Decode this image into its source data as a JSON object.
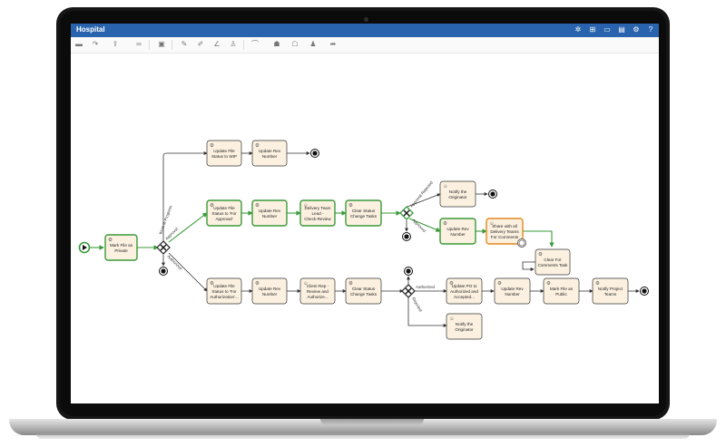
{
  "app": {
    "title": "Hospital"
  },
  "titlebar_icons": [
    "settings-gear-icon",
    "org-chart-icon",
    "chat-icon",
    "document-icon",
    "gear-icon",
    "help-icon"
  ],
  "toolbar_tools": [
    "open-folder-icon",
    "redo-icon",
    "upload-icon",
    "link-icon",
    "save-icon",
    "pencil-icon",
    "edit-icon",
    "angle-icon",
    "person-icon",
    "curve-icon",
    "users-icon",
    "group-icon",
    "add-user-icon",
    "forward-icon"
  ],
  "process": {
    "tasks": {
      "mark_private": "Mark File as Private",
      "update_wip": "Update File Status to WIP",
      "update_rev_top": "Update Rev Number",
      "update_for_approval": "Update File Status to 'For Approval'",
      "update_rev_mid": "Update Rev Number",
      "delivery_team": "Delivery Team Lead - Check-Review Approv...",
      "clear_status_mid": "Clear Status Change Tasks",
      "notify_originator_top": "Notify the Originator",
      "update_rev_right": "Update Rev Number",
      "share_delivery": "Share with all Delivery Teams For Comments",
      "clear_comments": "Clear For Comments Task",
      "update_for_authorization": "Update File Status to 'For Authorization'...",
      "update_rev_bottom": "Update Rev Number",
      "client_rep": "Client Rep - Review and Authorize...",
      "clear_status_bottom": "Clear Status Change Tasks",
      "update_po": "Update PO to Authorized and Accepted...",
      "update_rev_end": "Update Rev Number",
      "mark_public": "Mark File as Public",
      "notify_project": "Notify Project Teams",
      "notify_originator_bottom": "Notify the Originator"
    },
    "edge_labels": {
      "work_in_progress": "Work in Progress",
      "approval": "Approval",
      "authorized_left": "Authorized",
      "approval_rejected": "Approval Rejected",
      "approved": "Approved",
      "authorized": "Authorized",
      "rejected": "Rejected"
    }
  }
}
